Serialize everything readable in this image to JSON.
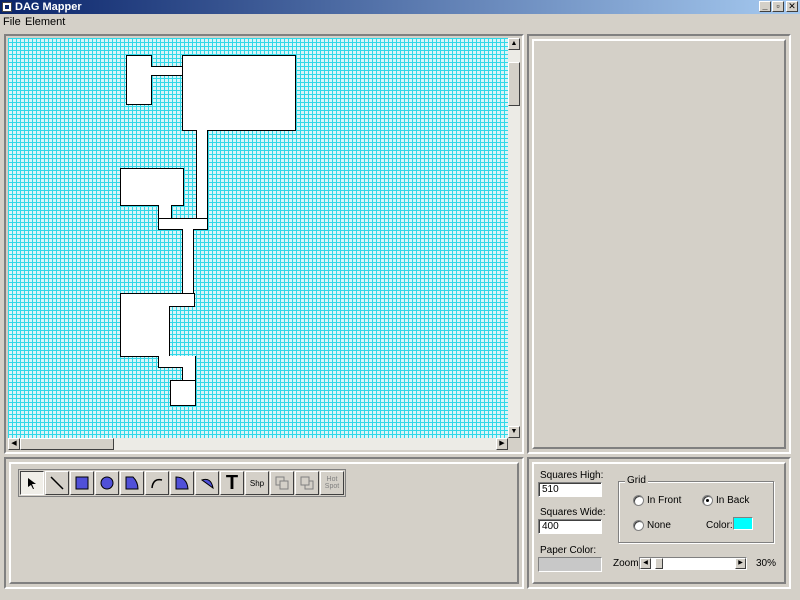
{
  "window": {
    "title": "DAG Mapper",
    "controls": {
      "minimize": "_",
      "maximize": "▫",
      "close": "✕"
    }
  },
  "menu": {
    "items": [
      "File",
      "Element"
    ]
  },
  "map": {
    "grid_color": "#30d8e8",
    "paper_color": "#d8f4f8"
  },
  "toolbar": {
    "tools": [
      {
        "name": "select-tool",
        "icon": "pointer-icon",
        "label": ""
      },
      {
        "name": "line-tool",
        "icon": "line-icon",
        "label": ""
      },
      {
        "name": "rectangle-tool",
        "icon": "rectangle-icon",
        "label": ""
      },
      {
        "name": "circle-tool",
        "icon": "circle-icon",
        "label": ""
      },
      {
        "name": "polygon-tool",
        "icon": "polygon-icon",
        "label": ""
      },
      {
        "name": "arc-tool",
        "icon": "arc-icon",
        "label": ""
      },
      {
        "name": "pie-tool",
        "icon": "pie-icon",
        "label": ""
      },
      {
        "name": "chord-tool",
        "icon": "chord-icon",
        "label": ""
      },
      {
        "name": "text-tool",
        "icon": "text-icon",
        "label": "T"
      },
      {
        "name": "shape-tool",
        "icon": "shape-icon",
        "label": "Shp"
      },
      {
        "name": "bring-front-tool",
        "icon": "bring-front-icon",
        "label": ""
      },
      {
        "name": "send-back-tool",
        "icon": "send-back-icon",
        "label": ""
      },
      {
        "name": "hot-spot-tool",
        "icon": "hot-spot-icon",
        "label": "Hot Spot"
      }
    ]
  },
  "settings": {
    "squares_high_label": "Squares High:",
    "squares_high_value": "510",
    "squares_wide_label": "Squares Wide:",
    "squares_wide_value": "400",
    "paper_color_label": "Paper Color:",
    "paper_color_value": "#c8c8c8",
    "grid": {
      "title": "Grid",
      "in_front": "In Front",
      "in_back": "In Back",
      "none": "None",
      "selected": "In Back",
      "color_label": "Color:",
      "color": "#00ffff"
    },
    "zoom_label": "Zoom:",
    "zoom_value": "30%",
    "zoom_percent": 30
  }
}
